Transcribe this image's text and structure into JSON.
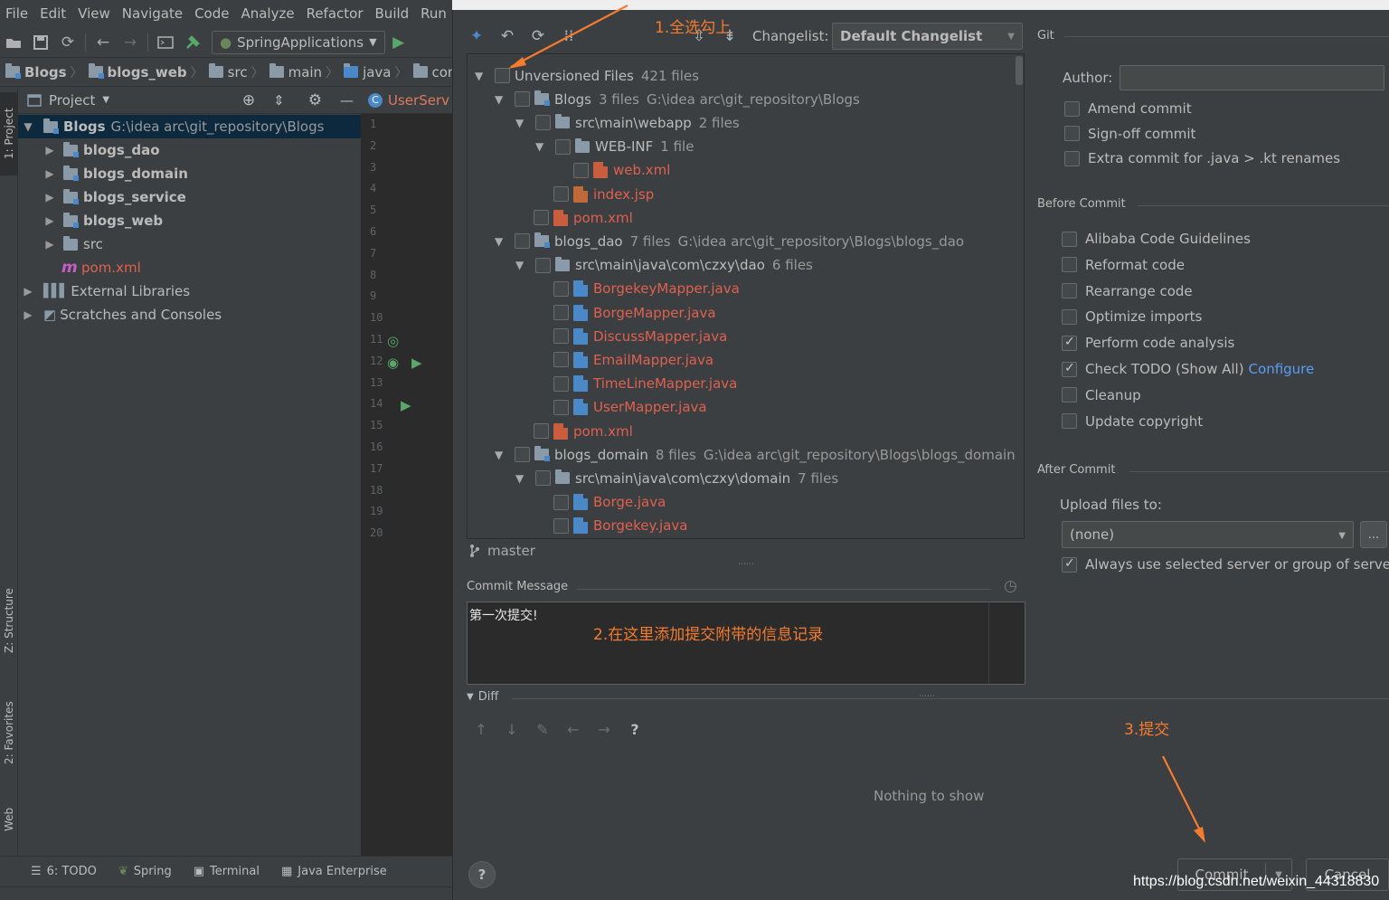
{
  "menubar": {
    "items": [
      "File",
      "Edit",
      "View",
      "Navigate",
      "Code",
      "Analyze",
      "Refactor",
      "Build",
      "Run"
    ]
  },
  "toolbar": {
    "run_config": "SpringApplications"
  },
  "navbar": {
    "crumbs": [
      "Blogs",
      "blogs_web",
      "src",
      "main",
      "java",
      "com"
    ]
  },
  "left_strip": {
    "project_tab": "1: Project",
    "structure_tab": "Z: Structure",
    "favorites_tab": "2: Favorites",
    "web_tab": "Web"
  },
  "project_panel": {
    "title": "Project",
    "tree": [
      {
        "name": "Blogs",
        "path": "G:\\idea arc\\git_repository\\Blogs"
      },
      {
        "name": "blogs_dao"
      },
      {
        "name": "blogs_domain"
      },
      {
        "name": "blogs_service"
      },
      {
        "name": "blogs_web"
      },
      {
        "name": "src"
      },
      {
        "name": "pom.xml"
      },
      {
        "name": "External Libraries"
      },
      {
        "name": "Scratches and Consoles"
      }
    ]
  },
  "editor": {
    "tab_label": "UserServ",
    "line_numbers": [
      "1",
      "2",
      "3",
      "4",
      "5",
      "6",
      "7",
      "8",
      "9",
      "10",
      "11",
      "12",
      "13",
      "14",
      "15",
      "16",
      "17",
      "18",
      "19",
      "20"
    ]
  },
  "bottom_bar": {
    "items": [
      "6: TODO",
      "Spring",
      "Terminal",
      "Java Enterprise"
    ]
  },
  "dialog": {
    "changelist_label": "Changelist:",
    "changelist_value": "Default Changelist",
    "file_tree": [
      {
        "label": "Unversioned Files",
        "meta": "421 files"
      },
      {
        "label": "Blogs",
        "meta": "3 files",
        "path": "G:\\idea arc\\git_repository\\Blogs"
      },
      {
        "label": "src\\main\\webapp",
        "meta": "2 files"
      },
      {
        "label": "WEB-INF",
        "meta": "1 file"
      },
      {
        "label": "web.xml"
      },
      {
        "label": "index.jsp"
      },
      {
        "label": "pom.xml"
      },
      {
        "label": "blogs_dao",
        "meta": "7 files",
        "path": "G:\\idea arc\\git_repository\\Blogs\\blogs_dao"
      },
      {
        "label": "src\\main\\java\\com\\czxy\\dao",
        "meta": "6 files"
      },
      {
        "label": "BorgekeyMapper.java"
      },
      {
        "label": "BorgeMapper.java"
      },
      {
        "label": "DiscussMapper.java"
      },
      {
        "label": "EmailMapper.java"
      },
      {
        "label": "TimeLineMapper.java"
      },
      {
        "label": "UserMapper.java"
      },
      {
        "label": "pom.xml"
      },
      {
        "label": "blogs_domain",
        "meta": "8 files",
        "path": "G:\\idea arc\\git_repository\\Blogs\\blogs_domain"
      },
      {
        "label": "src\\main\\java\\com\\czxy\\domain",
        "meta": "7 files"
      },
      {
        "label": "Borge.java"
      },
      {
        "label": "Borgekey.java"
      }
    ],
    "branch": "master",
    "commit_message_title": "Commit Message",
    "commit_message": "第一次提交!",
    "diff_title": "Diff",
    "diff_help": "?",
    "nothing_to_show": "Nothing to show",
    "help_label": "?",
    "commit_label": "Commit",
    "cancel_label": "Cancel",
    "more_label": "...",
    "git_section": "Git",
    "author_label": "Author:",
    "git_options": [
      {
        "label": "Amend commit",
        "checked": false
      },
      {
        "label": "Sign-off commit",
        "checked": false
      },
      {
        "label": "Extra commit for .java > .kt renames",
        "checked": false
      }
    ],
    "before_commit_title": "Before Commit",
    "before_commit": [
      {
        "label": "Alibaba Code Guidelines",
        "checked": false
      },
      {
        "label": "Reformat code",
        "checked": false
      },
      {
        "label": "Rearrange code",
        "checked": false
      },
      {
        "label": "Optimize imports",
        "checked": false
      },
      {
        "label": "Perform code analysis",
        "checked": true
      },
      {
        "label": "Check TODO (Show All)",
        "checked": true,
        "link": "Configure"
      },
      {
        "label": "Cleanup",
        "checked": false
      },
      {
        "label": "Update copyright",
        "checked": false
      }
    ],
    "after_commit_title": "After Commit",
    "upload_label": "Upload files to:",
    "upload_value": "(none)",
    "always_use": {
      "label": "Always use selected server or group of servers",
      "checked": true
    }
  },
  "annotations": {
    "step1": "1.全选勾上",
    "step2": "2.在这里添加提交附带的信息记录",
    "step3": "3.提交",
    "color": "#f57b2f"
  },
  "watermark": "https://blog.csdn.net/weixin_44318830"
}
